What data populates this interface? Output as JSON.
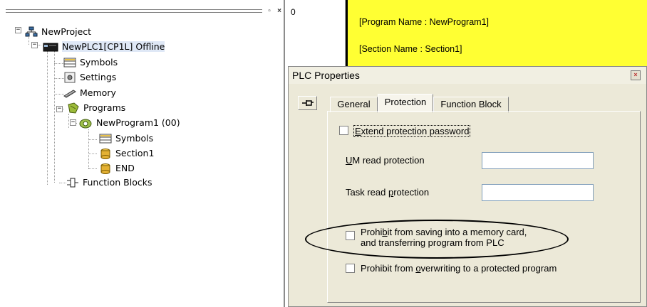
{
  "tree": {
    "items": [
      {
        "label": "NewProject",
        "icon": "project-network-icon"
      },
      {
        "label": "NewPLC1[CP1L] Offline",
        "icon": "plc-device-icon"
      },
      {
        "label": "Symbols",
        "icon": "symbols-table-icon"
      },
      {
        "label": "Settings",
        "icon": "settings-icon"
      },
      {
        "label": "Memory",
        "icon": "memory-card-icon"
      },
      {
        "label": "Programs",
        "icon": "programs-folder-icon"
      },
      {
        "label": "NewProgram1 (00)",
        "icon": "program-icon"
      },
      {
        "label": "Symbols",
        "icon": "symbols-table-icon"
      },
      {
        "label": "Section1",
        "icon": "section-icon"
      },
      {
        "label": "END",
        "icon": "section-icon"
      },
      {
        "label": "Function Blocks",
        "icon": "function-block-icon"
      }
    ]
  },
  "ladder": {
    "rung_number": "0",
    "program_name_line": "[Program Name : NewProgram1]",
    "section_name_line": "[Section Name : Section1]",
    "rung_color": "#ffff33"
  },
  "dialog": {
    "title": "PLC Properties",
    "tabs": [
      "General",
      "Protection",
      "Function Block"
    ],
    "active_tab": "Protection",
    "extend_pw": {
      "pre": "",
      "key": "E",
      "post": "xtend protection password",
      "checked": false
    },
    "um_read": {
      "pre": "",
      "key": "U",
      "post": "M read protection",
      "value": ""
    },
    "task_read": {
      "pre": "Task read ",
      "key": "p",
      "post": "rotection",
      "value": ""
    },
    "prohibit_save": {
      "line1_pre": "Prohi",
      "line1_key": "b",
      "line1_post": "it from saving into a memory card,",
      "line2": "and transferring program from PLC",
      "checked": false
    },
    "prohibit_overwrite": {
      "pre": "Prohibit from ",
      "key": "o",
      "post": "verwriting to a protected program",
      "checked": false
    }
  }
}
